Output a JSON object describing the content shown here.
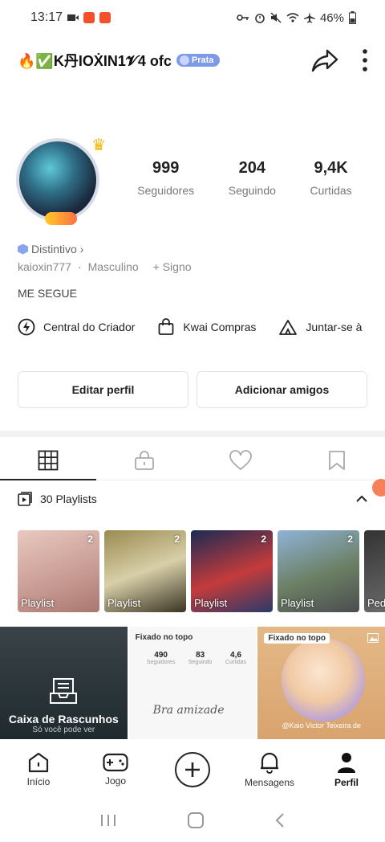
{
  "status_bar": {
    "time": "13:17",
    "battery": "46%"
  },
  "profile": {
    "name": "🔥✅K丹IOẊIN1𝓥4 ofc",
    "level_badge": "Prata",
    "stats": [
      {
        "value": "999",
        "label": "Seguidores"
      },
      {
        "value": "204",
        "label": "Seguindo"
      },
      {
        "value": "9,4K",
        "label": "Curtidas"
      }
    ],
    "distintivo": "Distintivo",
    "username": "kaioxin777",
    "gender": "Masculino",
    "sign": "Signo",
    "bio": "ME SEGUE"
  },
  "shortcuts": [
    {
      "label": "Central do Criador",
      "icon": "bolt-icon"
    },
    {
      "label": "Kwai Compras",
      "icon": "shopping-bag-icon"
    },
    {
      "label": "Juntar-se à",
      "icon": "tent-icon"
    }
  ],
  "buttons": {
    "edit_profile": "Editar perfil",
    "add_friends": "Adicionar amigos"
  },
  "tabs": [
    {
      "name": "grid",
      "icon": "grid-icon"
    },
    {
      "name": "private",
      "icon": "lock-icon"
    },
    {
      "name": "liked",
      "icon": "heart-icon"
    },
    {
      "name": "saved",
      "icon": "bookmark-icon"
    }
  ],
  "playlists": {
    "header": "30 Playlists",
    "items": [
      {
        "count": "2",
        "label": "Playlist"
      },
      {
        "count": "2",
        "label": "Playlist"
      },
      {
        "count": "2",
        "label": "Playlist"
      },
      {
        "count": "2",
        "label": "Playlist"
      },
      {
        "count": "",
        "label": "Pedi"
      }
    ]
  },
  "grid": {
    "drafts_title": "Caixa de Rascunhos",
    "drafts_sub": "Só você pode ver",
    "pinned_label": "Fixado no topo",
    "mini_stats": [
      {
        "value": "490",
        "label": "Seguidores"
      },
      {
        "value": "83",
        "label": "Seguindo"
      },
      {
        "value": "4,6",
        "label": "Curtidas"
      }
    ],
    "mini_script": "Bra amizade",
    "peach_pinned": "Fixado no topo",
    "peach_caption": "@Kaio Victor Teixeira de"
  },
  "bottom_nav": [
    {
      "label": "Início",
      "icon": "home-icon"
    },
    {
      "label": "Jogo",
      "icon": "gamepad-icon"
    },
    {
      "label": "",
      "icon": "plus-icon"
    },
    {
      "label": "Mensagens",
      "icon": "bell-icon"
    },
    {
      "label": "Perfil",
      "icon": "person-icon"
    }
  ],
  "colors": {
    "accent_orange": "#f26b3a",
    "badge_blue": "#7d9ae8"
  }
}
